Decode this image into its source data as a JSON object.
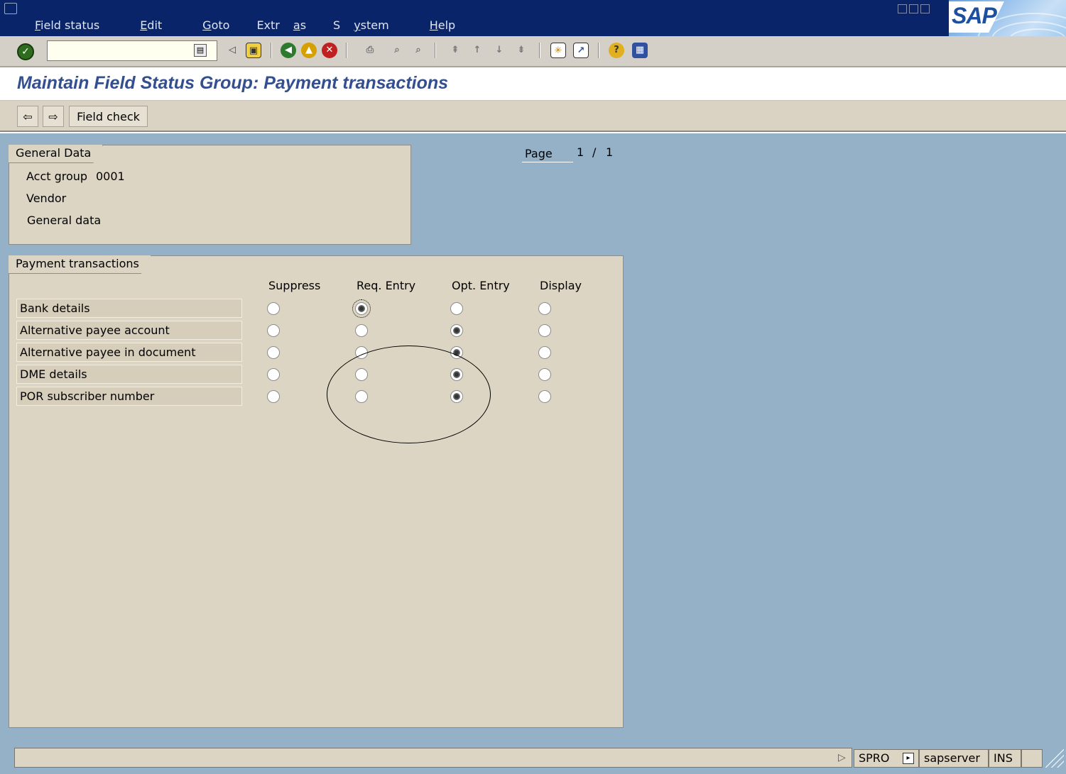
{
  "menu": {
    "items": [
      {
        "label_pre": "",
        "label_u": "F",
        "label_post": "ield status"
      },
      {
        "label_pre": "",
        "label_u": "E",
        "label_post": "dit"
      },
      {
        "label_pre": "",
        "label_u": "G",
        "label_post": "oto"
      },
      {
        "label_pre": "Extr",
        "label_u": "a",
        "label_post": "s"
      },
      {
        "label_pre": "S",
        "label_u": "y",
        "label_post": "stem"
      },
      {
        "label_pre": "",
        "label_u": "H",
        "label_post": "elp"
      }
    ]
  },
  "logo": {
    "text": "SAP"
  },
  "toolbar": {
    "command_value": "",
    "icons": [
      "enter-icon",
      "back-arrow-icon",
      "save-icon",
      "back-icon",
      "exit-icon",
      "cancel-icon",
      "print-icon",
      "find-icon",
      "find-next-icon",
      "first-page-icon",
      "previous-page-icon",
      "next-page-icon",
      "last-page-icon",
      "create-session-icon",
      "shortcut-icon",
      "help-icon",
      "layout-menu-icon"
    ]
  },
  "page": {
    "title": "Maintain Field Status Group: Payment transactions"
  },
  "app_toolbar": {
    "field_check_label": "Field check"
  },
  "general_data": {
    "title": "General Data",
    "acct_group_label": "Acct group",
    "acct_group_value": "0001",
    "line2": "Vendor",
    "line3": "General data"
  },
  "page_indicator": {
    "label": "Page",
    "current": "1",
    "sep": "/",
    "total": "1"
  },
  "payment": {
    "title": "Payment transactions",
    "columns": [
      "Suppress",
      "Req. Entry",
      "Opt. Entry",
      "Display"
    ],
    "rows": [
      {
        "label": "Bank details",
        "selected": 1
      },
      {
        "label": "Alternative payee account",
        "selected": 2
      },
      {
        "label": "Alternative payee in document",
        "selected": 2
      },
      {
        "label": "DME details",
        "selected": 2
      },
      {
        "label": "POR subscriber number",
        "selected": 2
      }
    ]
  },
  "status": {
    "message": "",
    "transaction": "SPRO",
    "server": "sapserver",
    "mode": "INS"
  },
  "colors": {
    "title_bar": "#0a246a",
    "title_text": "#344f8f",
    "content_bg": "#94b1c8",
    "group_bg": "#ddd5c3"
  }
}
